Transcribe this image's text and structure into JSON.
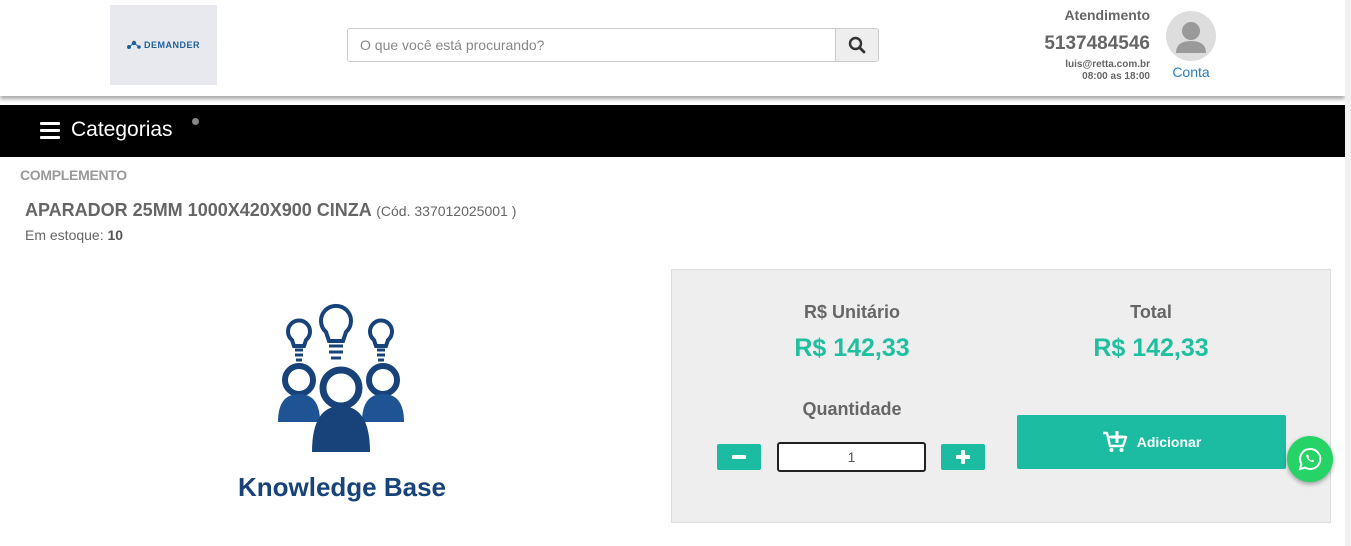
{
  "header": {
    "logo_text": "DEMANDER",
    "search": {
      "placeholder": "O que você está procurando?"
    },
    "contact": {
      "label": "Atendimento",
      "phone": "5137484546",
      "email": "luis@retta.com.br",
      "hours": "08:00 as 18:00"
    },
    "account_label": "Conta"
  },
  "nav": {
    "categories_label": "Categorias"
  },
  "product": {
    "category": "COMPLEMENTO",
    "title": "APARADOR 25MM 1000X420X900 CINZA",
    "code": "(Cód. 337012025001 )",
    "stock_label": "Em estoque:",
    "stock_value": "10",
    "image_caption": "Knowledge Base"
  },
  "buy_panel": {
    "unit_label": "R$ Unitário",
    "unit_price": "R$ 142,33",
    "total_label": "Total",
    "total_price": "R$ 142,33",
    "quantity_label": "Quantidade",
    "quantity_value": "1",
    "add_label": "Adicionar"
  },
  "colors": {
    "accent": "#1bbca1",
    "price": "#1fbf9f",
    "navbar": "#000000",
    "whatsapp": "#25d366",
    "link": "#2b7bbf"
  },
  "icons": [
    "search-icon",
    "user-avatar-icon",
    "hamburger-menu-icon",
    "minus-icon",
    "plus-icon",
    "cart-add-icon",
    "whatsapp-icon"
  ]
}
